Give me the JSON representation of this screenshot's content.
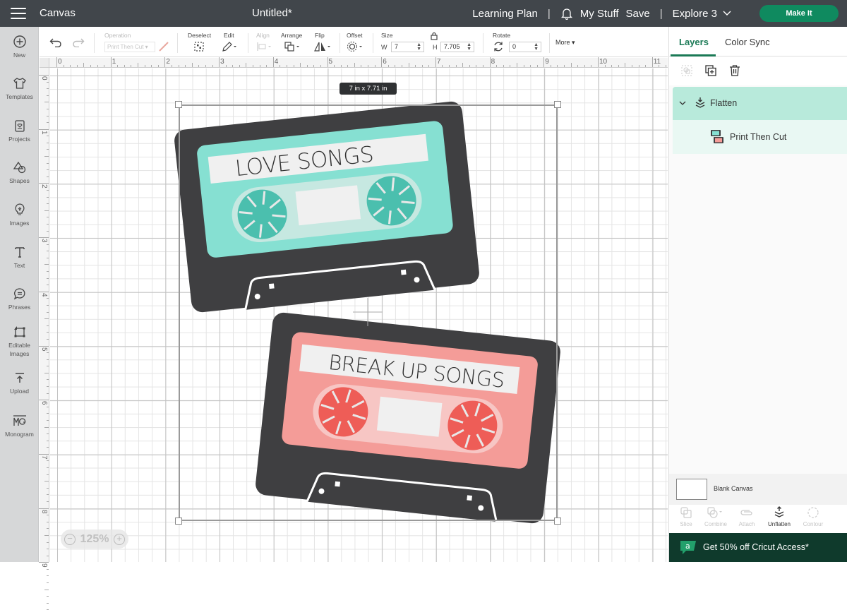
{
  "topbar": {
    "app_title": "Canvas",
    "doc_title": "Untitled*",
    "learning_plan": "Learning Plan",
    "separator": "|",
    "my_stuff": "My Stuff",
    "save": "Save",
    "machine": "Explore 3",
    "make_it": "Make It"
  },
  "sidebar": {
    "items": [
      {
        "label": "New",
        "icon": "plus-circle-icon"
      },
      {
        "label": "Templates",
        "icon": "tshirt-icon"
      },
      {
        "label": "Projects",
        "icon": "projects-icon"
      },
      {
        "label": "Shapes",
        "icon": "shapes-icon"
      },
      {
        "label": "Images",
        "icon": "lightbulb-icon"
      },
      {
        "label": "Text",
        "icon": "text-icon"
      },
      {
        "label": "Phrases",
        "icon": "speech-bubble-icon"
      },
      {
        "label": "Editable",
        "label2": "Images",
        "icon": "editable-images-icon"
      },
      {
        "label": "Upload",
        "icon": "upload-icon"
      },
      {
        "label": "Monogram",
        "icon": "monogram-icon"
      }
    ]
  },
  "toolbar": {
    "operation_label": "Operation",
    "operation_value": "Print Then Cut",
    "deselect_label": "Deselect",
    "edit_label": "Edit",
    "align_label": "Align",
    "arrange_label": "Arrange",
    "flip_label": "Flip",
    "offset_label": "Offset",
    "size_label": "Size",
    "w_label": "W",
    "w_value": "7",
    "h_label": "H",
    "h_value": "7.705",
    "rotate_label": "Rotate",
    "rotate_value": "0",
    "more_label": "More"
  },
  "rulers": {
    "top": [
      "0",
      "1",
      "2",
      "3",
      "4",
      "5",
      "6",
      "7",
      "8",
      "9",
      "10",
      "11"
    ],
    "left": [
      "0",
      "1",
      "2",
      "3",
      "4",
      "5",
      "6",
      "7",
      "8",
      "9"
    ]
  },
  "canvas": {
    "dimension_tooltip": "7  in x 7.71  in",
    "zoom_level": "125%",
    "zoom_out": "−",
    "zoom_in": "+",
    "cassettes": [
      {
        "label": "LOVE SONGS",
        "body_color": "#3f3f41",
        "shell_color": "#86e0d2",
        "window_color": "#c6e8e1",
        "reel_color": "#4bbfae",
        "label_bg": "#f0f0f0"
      },
      {
        "label": "BREAK UP SONGS",
        "body_color": "#3f3f41",
        "shell_color": "#f49c98",
        "window_color": "#f7c6c4",
        "reel_color": "#ee5d57",
        "label_bg": "#f0f0f0"
      }
    ]
  },
  "panel": {
    "tabs": [
      {
        "label": "Layers",
        "active": true
      },
      {
        "label": "Color Sync",
        "active": false
      }
    ],
    "layers": {
      "group": "Flatten",
      "child": "Print Then Cut"
    },
    "blank_canvas": "Blank Canvas",
    "bottom_tools": [
      {
        "label": "Slice",
        "enabled": false
      },
      {
        "label": "Combine",
        "enabled": false
      },
      {
        "label": "Attach",
        "enabled": false
      },
      {
        "label": "Unflatten",
        "enabled": true
      },
      {
        "label": "Contour",
        "enabled": false
      }
    ],
    "promo": "Get 50% off Cricut Access*"
  },
  "colors": {
    "topbar_bg": "#41464b",
    "accent_green": "#0f8a5f",
    "layer_selected": "#b8eadb",
    "promo_bg": "#0f3a2c"
  }
}
